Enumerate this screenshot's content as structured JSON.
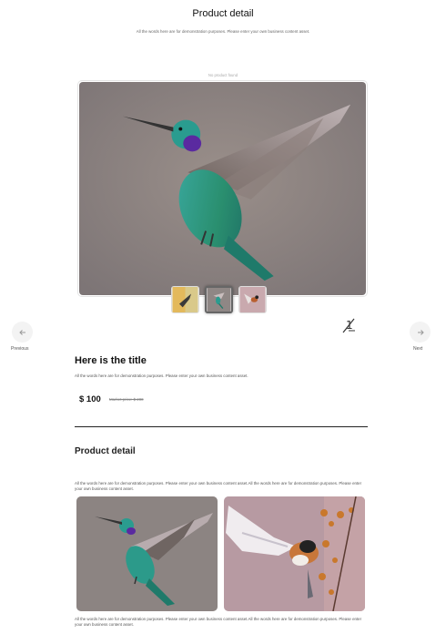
{
  "page": {
    "title": "Product detail",
    "subtitle": "All the words here are for demonstration purposes. Please enter your own business content asset."
  },
  "hero": {
    "caption": "No product found",
    "image_icon": "hummingbird-photo",
    "thumbnails": [
      {
        "name": "thumb-yellow-bird",
        "active": false
      },
      {
        "name": "thumb-hummingbird",
        "active": true
      },
      {
        "name": "thumb-flying-bird",
        "active": false
      }
    ]
  },
  "nav": {
    "previous_label": "Previous",
    "next_label": "Next",
    "previous_icon": "arrow-left-icon",
    "next_icon": "arrow-right-icon"
  },
  "product": {
    "title": "Here is the title",
    "description": "All the words here are for demonstration purposes. Please enter your own business content asset.",
    "price": "$ 100",
    "original_price": "Market price: $ 200",
    "sale_icon": "discount-tag-icon"
  },
  "detail": {
    "title": "Product detail",
    "description": "All the words here are for demonstration purposes. Please enter your own business content asset.All the words here are for demonstration purposes. Please enter your own business content asset.",
    "images": [
      {
        "name": "hummingbird-photo"
      },
      {
        "name": "bird-with-flowers-photo"
      }
    ],
    "footer_text": "All the words here are for demonstration purposes. Please enter your own business content asset.All the words here are for demonstration purposes. Please enter your own business content asset."
  },
  "colors": {
    "accent": "#222222",
    "muted_text": "#555555",
    "nav_bg": "#f3f3f3"
  }
}
